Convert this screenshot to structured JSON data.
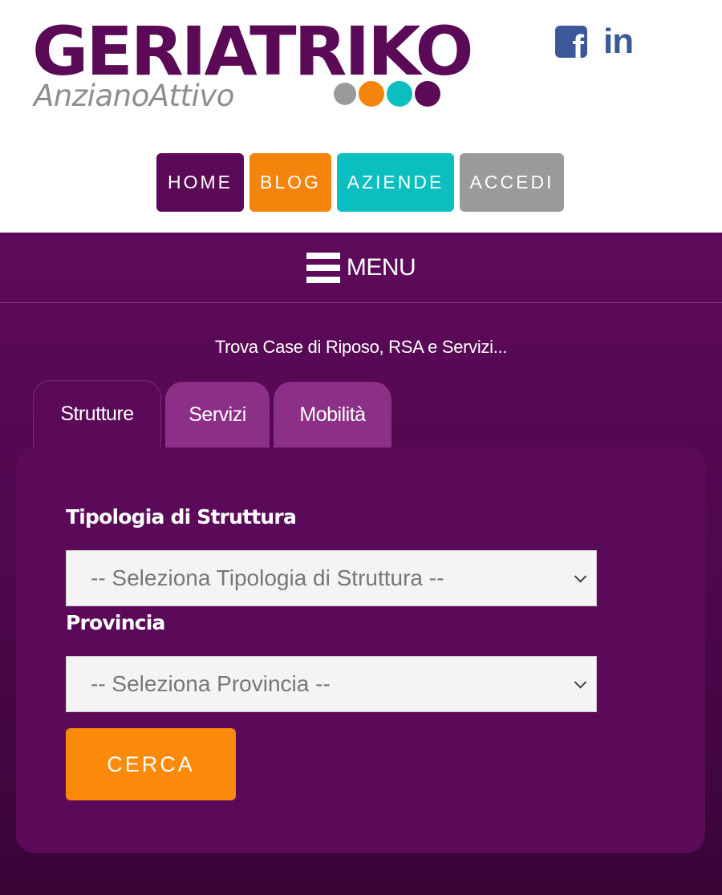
{
  "header": {
    "logo": {
      "main": "GERIATRIKO",
      "sub": "AnzianoAttivo",
      "dots": [
        "#9a9a9a",
        "#f5840c",
        "#0bbfc0",
        "#5b0a58"
      ]
    },
    "social": {
      "facebook_icon": "facebook-icon",
      "linkedin_label": "in",
      "brand_color": "#3b5998"
    },
    "nav": [
      {
        "label": "HOME",
        "color": "#5b0a58"
      },
      {
        "label": "BLOG",
        "color": "#f5840c"
      },
      {
        "label": "AZIENDE",
        "color": "#0bbfc0"
      },
      {
        "label": "ACCEDI",
        "color": "#9a9a9a"
      }
    ]
  },
  "menu": {
    "icon": "hamburger-icon",
    "label": "MENU"
  },
  "search": {
    "tagline": "Trova Case di Riposo, RSA e Servizi...",
    "tabs": [
      {
        "label": "Strutture",
        "active": true
      },
      {
        "label": "Servizi",
        "active": false
      },
      {
        "label": "Mobilità",
        "active": false
      }
    ],
    "fields": {
      "tipologia": {
        "label": "Tipologia di Struttura",
        "selected": "-- Seleziona Tipologia di Struttura --"
      },
      "provincia": {
        "label": "Provincia",
        "selected": "-- Seleziona Provincia --"
      }
    },
    "submit": {
      "label": "CERCA",
      "color": "#fc8a0a"
    }
  }
}
